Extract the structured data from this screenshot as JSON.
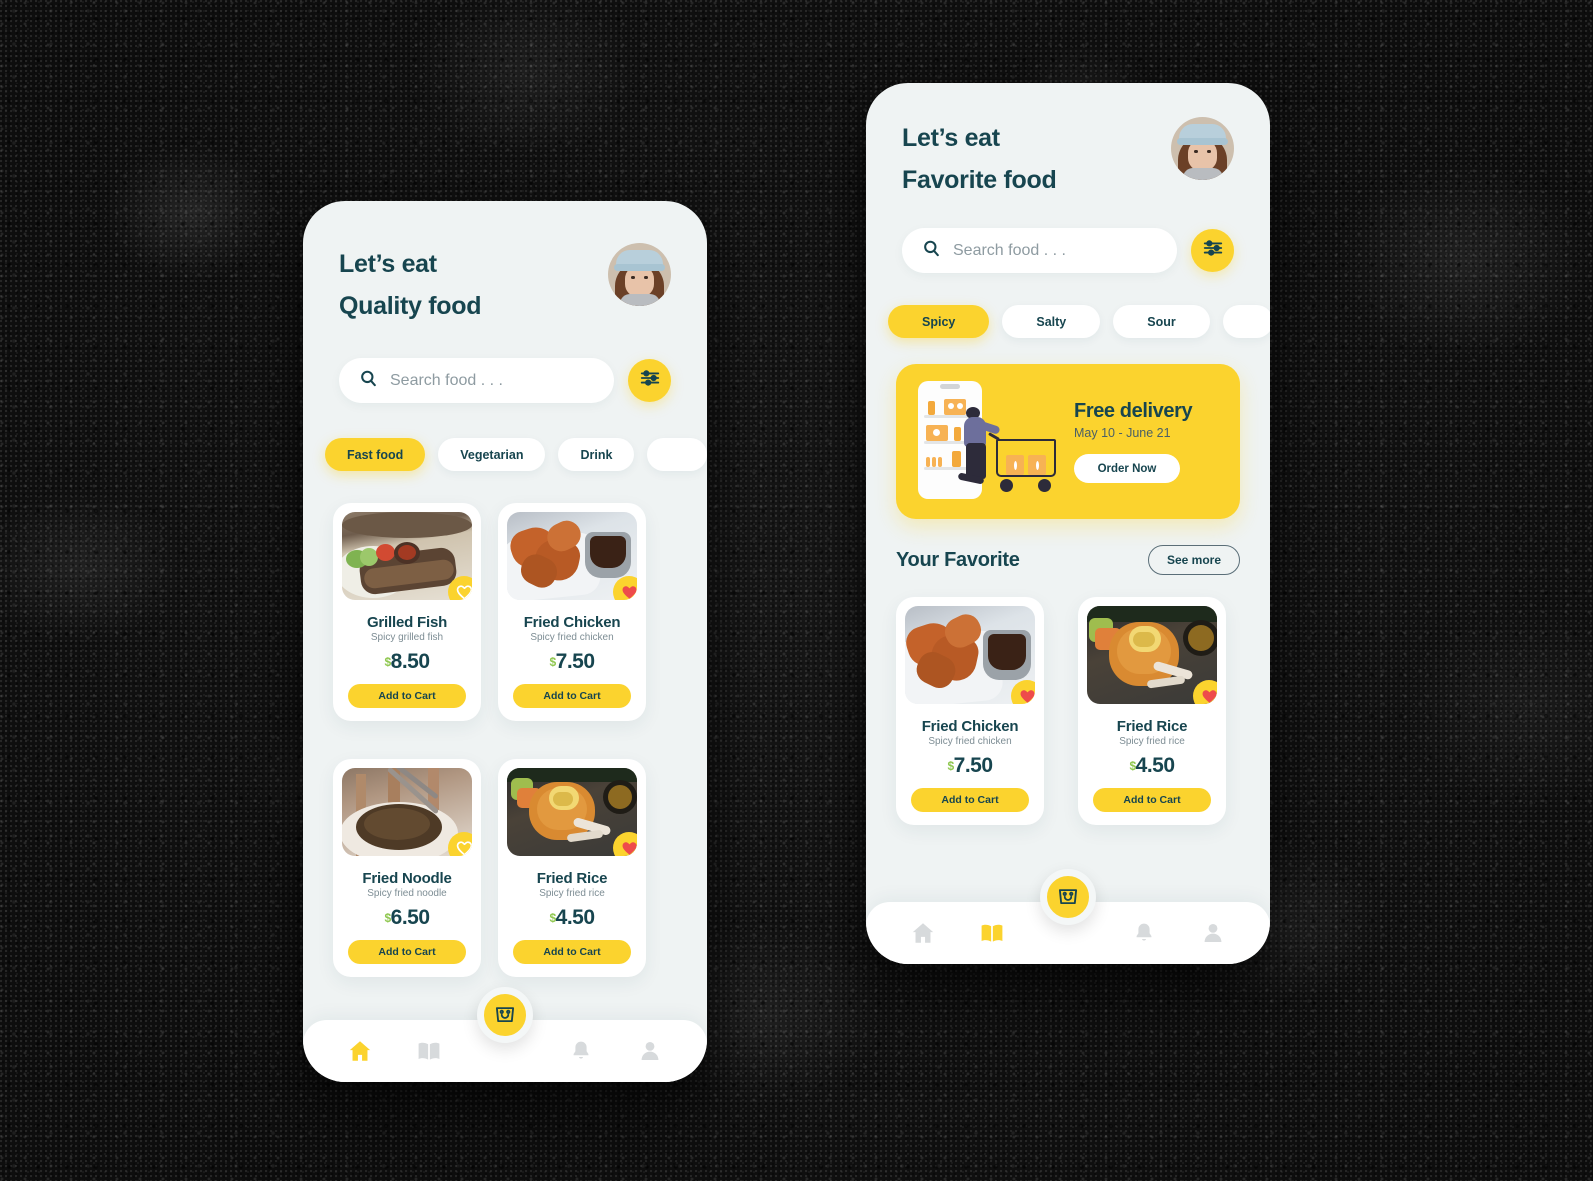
{
  "theme": {
    "accent_yellow": "#FBD32E",
    "dark_teal": "#17454F",
    "price_currency_green": "#8FC74F",
    "screen_bg": "#EFF3F3",
    "card_white": "#FFFFFF",
    "muted_text": "#7D8D94",
    "backdrop": "#232323"
  },
  "left_phone": {
    "header": {
      "greeting_line1": "Let’s eat",
      "greeting_line2": "Quality food",
      "avatar_name": "user-avatar"
    },
    "search": {
      "placeholder": "Search food . . .",
      "value": "",
      "search_icon": "search-icon",
      "filter_icon": "sliders-filter-icon"
    },
    "chips": [
      {
        "label": "Fast food",
        "active": true
      },
      {
        "label": "Vegetarian",
        "active": false
      },
      {
        "label": "Drink",
        "active": false
      },
      {
        "label": "",
        "active": false
      }
    ],
    "foods": [
      {
        "name": "Grilled Fish",
        "desc": "Spicy grilled fish",
        "currency": "$",
        "price": "8.50",
        "favorite": false,
        "add_label": "Add to Cart",
        "image": "grilled-fish-photo"
      },
      {
        "name": "Fried Chicken",
        "desc": "Spicy fried chicken",
        "currency": "$",
        "price": "7.50",
        "favorite": true,
        "add_label": "Add to Cart",
        "image": "fried-chicken-photo"
      },
      {
        "name": "Fried Noodle",
        "desc": "Spicy fried noodle",
        "currency": "$",
        "price": "6.50",
        "favorite": false,
        "add_label": "Add to Cart",
        "image": "fried-noodle-photo"
      },
      {
        "name": "Fried Rice",
        "desc": "Spicy fried rice",
        "currency": "$",
        "price": "4.50",
        "favorite": true,
        "add_label": "Add to Cart",
        "image": "fried-rice-photo"
      }
    ],
    "bottom_nav": {
      "items": [
        {
          "icon": "home-icon",
          "active": true
        },
        {
          "icon": "book-icon",
          "active": false
        },
        {
          "icon": "bell-icon",
          "active": false
        },
        {
          "icon": "person-icon",
          "active": false
        }
      ],
      "fab_icon": "shopping-bag-icon"
    }
  },
  "right_phone": {
    "header": {
      "greeting_line1": "Let’s eat",
      "greeting_line2": "Favorite food",
      "avatar_name": "user-avatar"
    },
    "search": {
      "placeholder": "Search food . . .",
      "value": "",
      "search_icon": "search-icon",
      "filter_icon": "sliders-filter-icon"
    },
    "chips": [
      {
        "label": "Spicy",
        "active": true
      },
      {
        "label": "Salty",
        "active": false
      },
      {
        "label": "Sour",
        "active": false
      },
      {
        "label": "",
        "active": false
      }
    ],
    "promo": {
      "title": "Free delivery",
      "subtitle": "May 10 - June 21",
      "button_label": "Order Now",
      "illustration": "shopper-with-cart-illustration"
    },
    "section": {
      "title": "Your Favorite",
      "see_more_label": "See more"
    },
    "foods": [
      {
        "name": "Fried Chicken",
        "desc": "Spicy fried chicken",
        "currency": "$",
        "price": "7.50",
        "favorite": true,
        "add_label": "Add to Cart",
        "image": "fried-chicken-photo"
      },
      {
        "name": "Fried Rice",
        "desc": "Spicy fried rice",
        "currency": "$",
        "price": "4.50",
        "favorite": true,
        "add_label": "Add to Cart",
        "image": "fried-rice-photo"
      }
    ],
    "bottom_nav": {
      "items": [
        {
          "icon": "home-icon",
          "active": false
        },
        {
          "icon": "book-icon",
          "active": true
        },
        {
          "icon": "bell-icon",
          "active": false
        },
        {
          "icon": "person-icon",
          "active": false
        }
      ],
      "fab_icon": "shopping-bag-icon"
    }
  }
}
